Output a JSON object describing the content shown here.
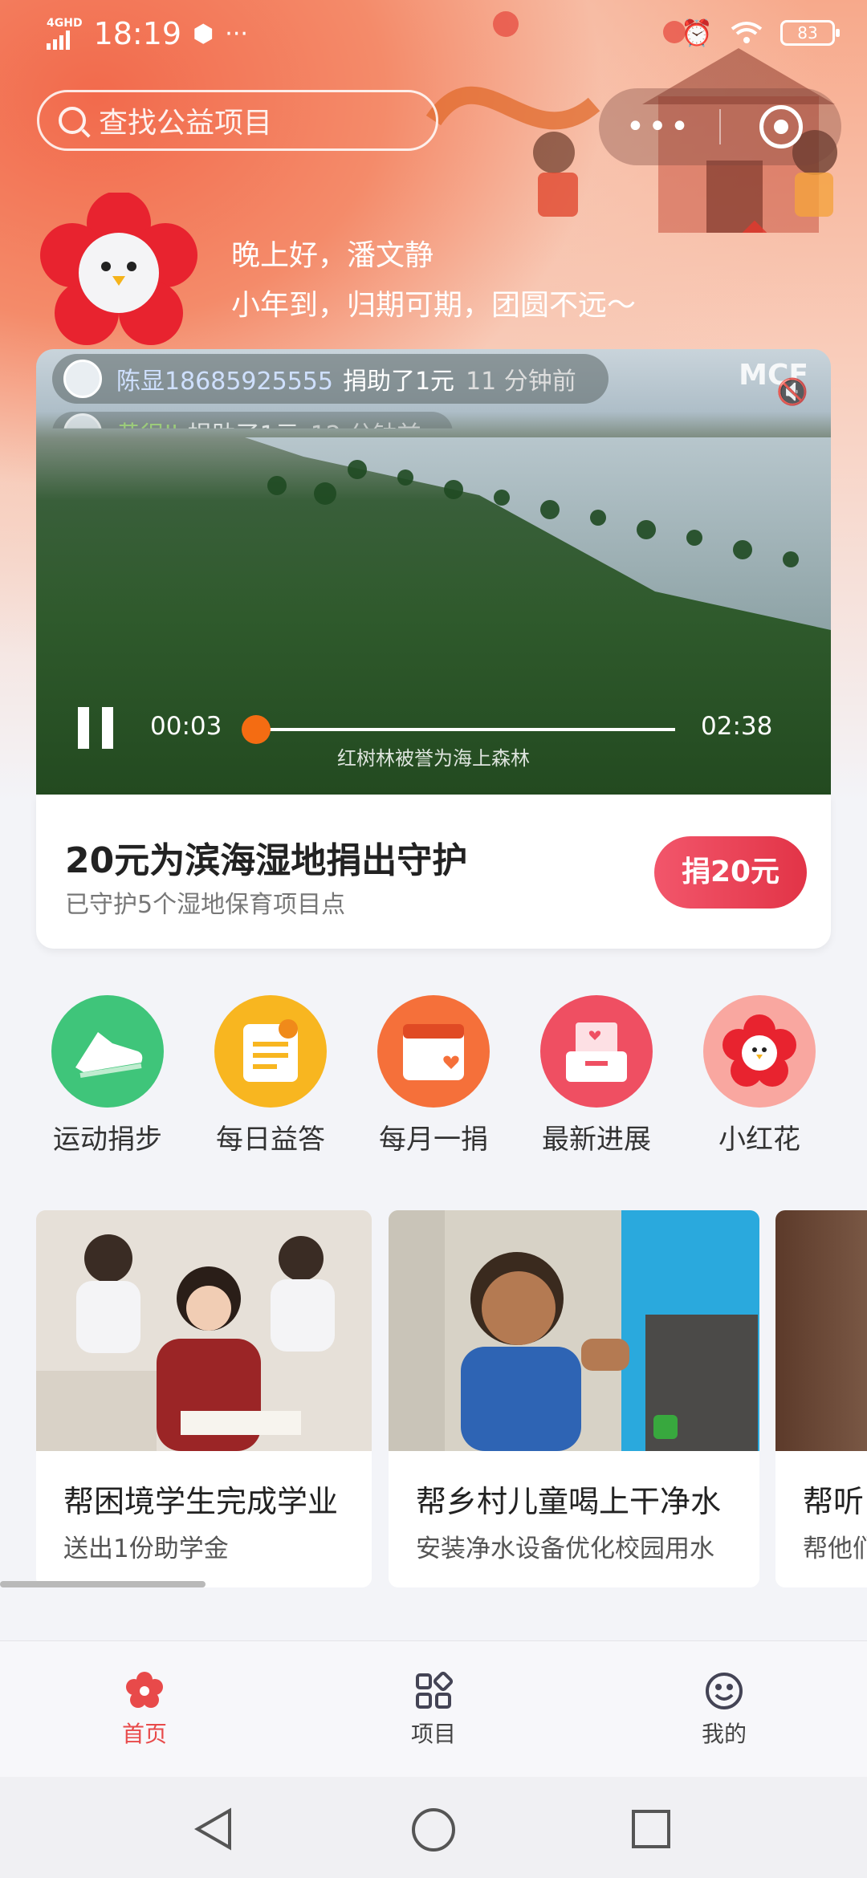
{
  "status_bar": {
    "network": "4GHD",
    "time": "18:19",
    "battery": "83"
  },
  "search": {
    "placeholder": "查找公益项目"
  },
  "capsule": {
    "more_label": "•••"
  },
  "greeting": {
    "line1": "晚上好，潘文静",
    "line2": "小年到，归期可期，团圆不远～"
  },
  "video": {
    "tickers": [
      {
        "name": "陈显18685925555",
        "action": "捐助了1元",
        "time": "11 分钟前"
      },
      {
        "name": "黄很ll",
        "action": "捐助了1元",
        "time": "12 分钟前"
      }
    ],
    "logo": "MCF",
    "current_time": "00:03",
    "total_time": "02:38",
    "progress": 0.02,
    "caption": "红树林被誉为海上森林"
  },
  "feature_card": {
    "title": "20元为滨海湿地捐出守护",
    "subtitle": "已守护5个湿地保育项目点",
    "button": "捐20元"
  },
  "shortcuts": [
    {
      "label": "运动捐步",
      "icon": "sneaker-icon",
      "color": "#3fc57a"
    },
    {
      "label": "每日益答",
      "icon": "quiz-icon",
      "color": "#f8b620"
    },
    {
      "label": "每月一捐",
      "icon": "calendar-heart-icon",
      "color": "#f5703a"
    },
    {
      "label": "最新进展",
      "icon": "inbox-heart-icon",
      "color": "#ef4f62"
    },
    {
      "label": "小红花",
      "icon": "red-flower-icon",
      "color": "#f9a7a0"
    }
  ],
  "projects": [
    {
      "title": "帮困境学生完成学业",
      "subtitle": "送出1份助学金"
    },
    {
      "title": "帮乡村儿童喝上干净水",
      "subtitle": "安装净水设备优化校园用水"
    },
    {
      "title": "帮听",
      "subtitle": "帮他们"
    }
  ],
  "tabbar": [
    {
      "label": "首页",
      "icon": "flower-icon",
      "active": true
    },
    {
      "label": "项目",
      "icon": "grid-icon",
      "active": false
    },
    {
      "label": "我的",
      "icon": "smiley-icon",
      "active": false
    }
  ],
  "colors": {
    "accent": "#e84a4a",
    "donate_button": "#e23447",
    "progress_knob": "#f46c12"
  }
}
